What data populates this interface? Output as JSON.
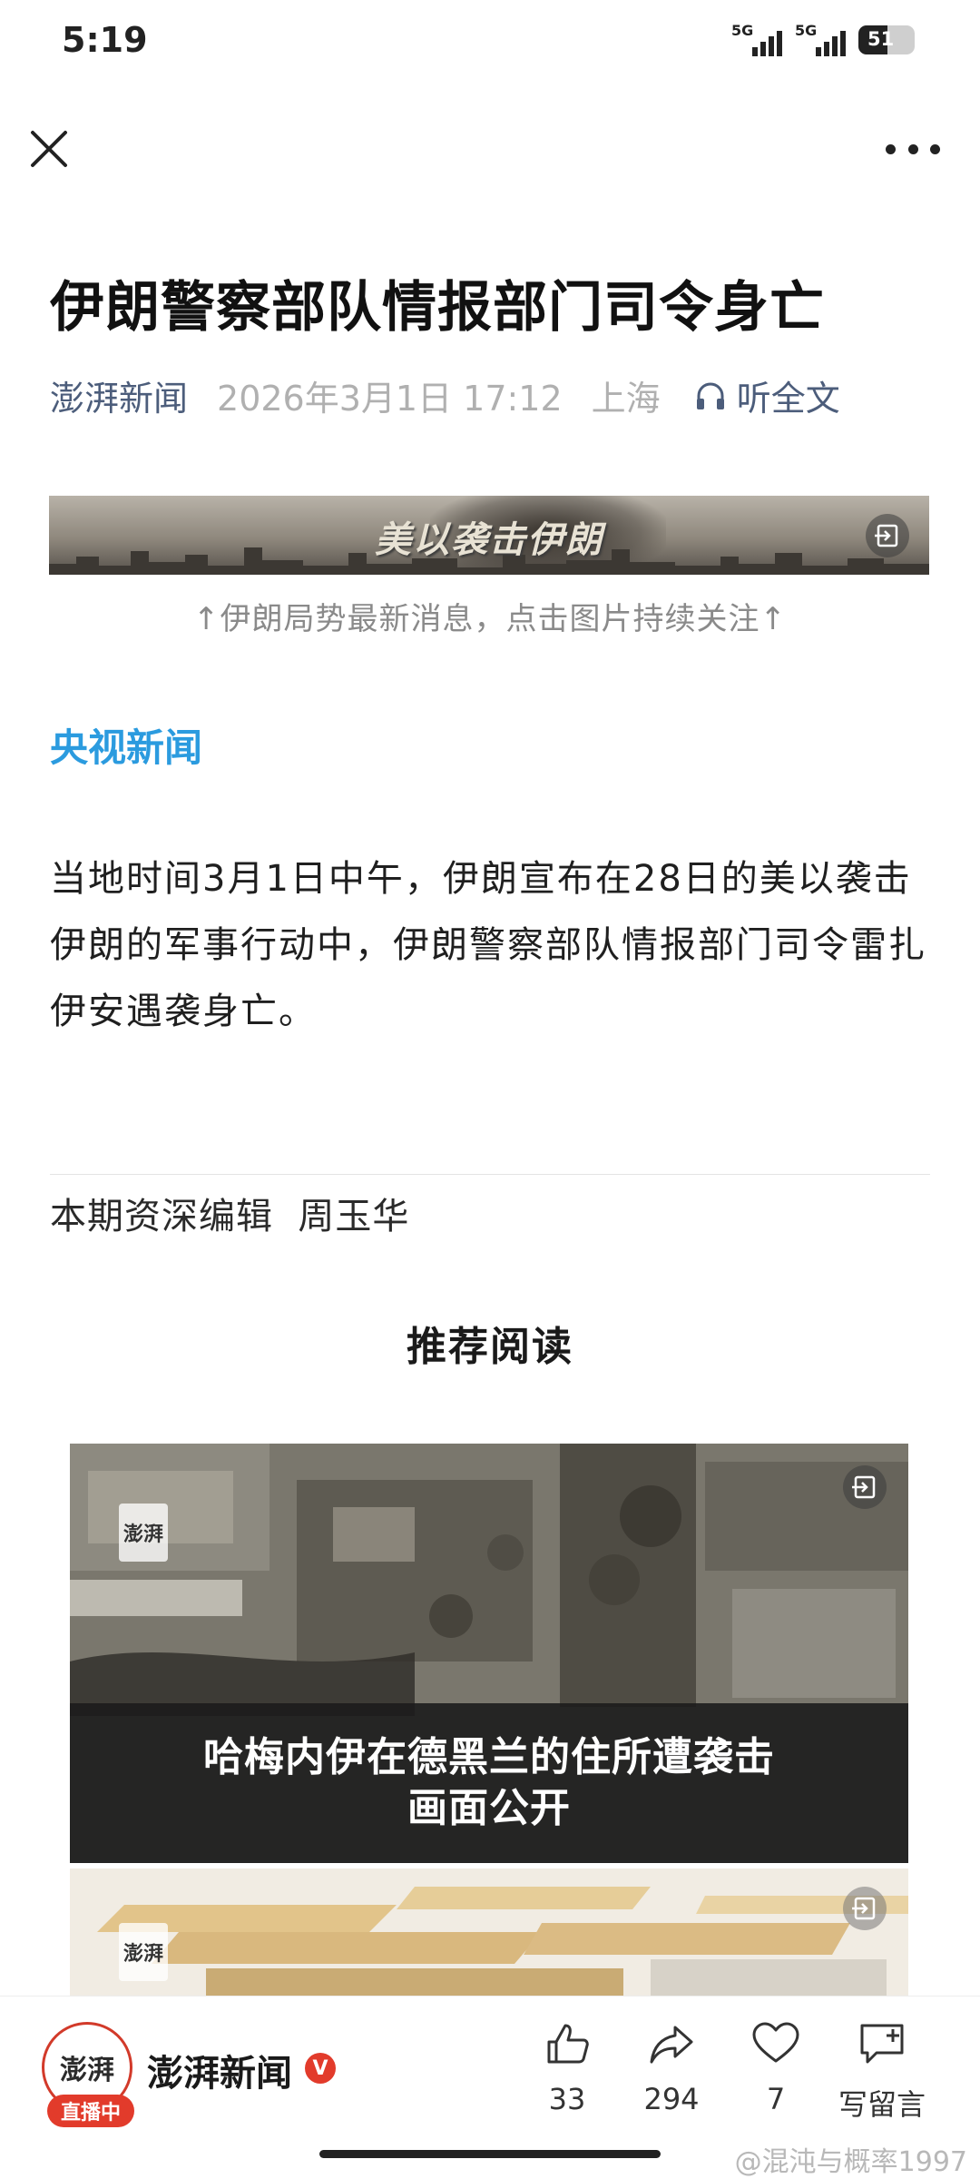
{
  "status_bar": {
    "time": "5:19",
    "signal1_label": "5G",
    "signal2_label": "5G",
    "battery": "51"
  },
  "article": {
    "title": "伊朗警察部队情报部门司令身亡",
    "source": "澎湃新闻",
    "date": "2026年3月1日 17:12",
    "location": "上海",
    "listen_label": "听全文",
    "banner_caption": "美以袭击伊朗",
    "banner_note": "↑伊朗局势最新消息，点击图片持续关注↑",
    "source_name": "央视新闻",
    "paragraph": "当地时间3月1日中午，伊朗宣布在28日的美以袭击伊朗的军事行动中，伊朗警察部队情报部门司令雷扎伊安遇袭身亡。",
    "editor": "本期资深编辑  周玉华"
  },
  "recommended": {
    "title": "推荐阅读",
    "card1_line1": "哈梅内伊在德黑兰的住所遭袭击",
    "card1_line2": "画面公开",
    "watermark": "澎湃"
  },
  "bottom_bar": {
    "account_name": "澎湃新闻",
    "avatar_text": "澎湃",
    "live_label": "直播中",
    "verified_mark": "V",
    "likes": "33",
    "shares": "294",
    "favorites": "7",
    "comment_label": "写留言"
  },
  "watermark": "@混沌与概率1997",
  "colors": {
    "link_blue": "#4c5d7b",
    "source_blue": "#2b9bdf",
    "live_red": "#e23b2b"
  },
  "icons": [
    "close-icon",
    "more-icon",
    "headphones-icon",
    "expand-icon",
    "like-icon",
    "share-icon",
    "favorite-icon",
    "comment-icon"
  ]
}
